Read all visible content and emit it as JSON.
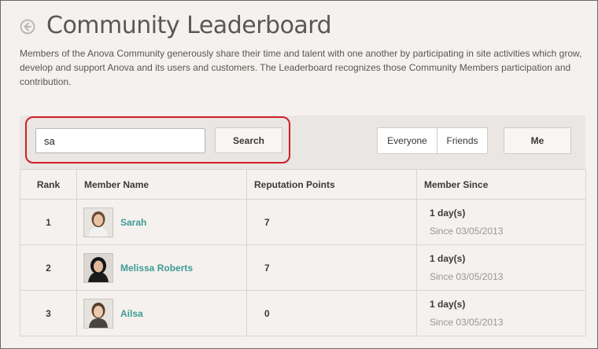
{
  "header": {
    "title": "Community Leaderboard",
    "description": "Members of the Anova Community generously share their time and talent with one another by participating in site activities which grow, develop and support Anova and its users and customers. The Leaderboard recognizes those Community Members participation and contribution."
  },
  "toolbar": {
    "search_value": "sa",
    "search_label": "Search",
    "everyone_label": "Everyone",
    "friends_label": "Friends",
    "me_label": "Me"
  },
  "table": {
    "headers": {
      "rank": "Rank",
      "member": "Member Name",
      "points": "Reputation Points",
      "since": "Member Since"
    },
    "rows": [
      {
        "rank": "1",
        "name": "Sarah",
        "points": "7",
        "duration": "1 day(s)",
        "since": "Since 03/05/2013"
      },
      {
        "rank": "2",
        "name": "Melissa Roberts",
        "points": "7",
        "duration": "1 day(s)",
        "since": "Since 03/05/2013"
      },
      {
        "rank": "3",
        "name": "Ailsa",
        "points": "0",
        "duration": "1 day(s)",
        "since": "Since 03/05/2013"
      }
    ]
  },
  "colors": {
    "accent_link": "#3d9c94",
    "highlight": "#d11f25",
    "background": "#f5f1ee"
  },
  "icons": {
    "back": "back-arrow-circle-icon"
  }
}
